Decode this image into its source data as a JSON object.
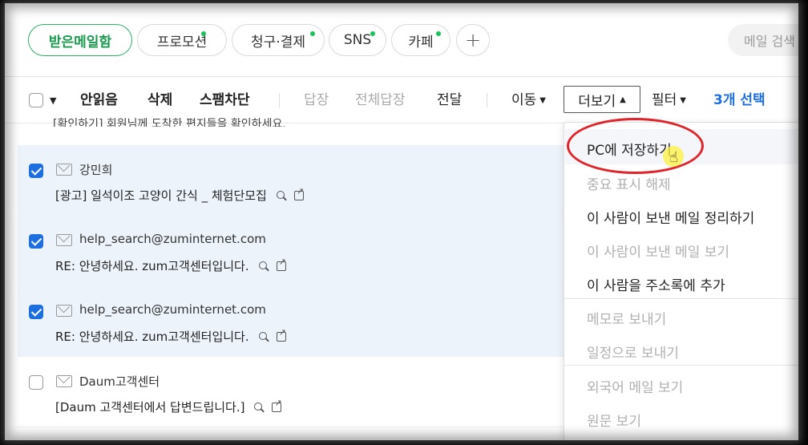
{
  "tabs": [
    {
      "label": "받은메일함",
      "active": true,
      "dot": false
    },
    {
      "label": "프로모션",
      "active": false,
      "dot": true
    },
    {
      "label": "청구·결제",
      "active": false,
      "dot": true
    },
    {
      "label": "SNS",
      "active": false,
      "dot": true
    },
    {
      "label": "카페",
      "active": false,
      "dot": true
    },
    {
      "label": "+",
      "active": false,
      "dot": false
    }
  ],
  "search": {
    "placeholder": "메일 검색"
  },
  "toolbar": {
    "mark_unread": "안읽음",
    "delete": "삭제",
    "block_spam": "스팸차단",
    "reply": "답장",
    "reply_all": "전체답장",
    "forward": "전달",
    "move": "이동",
    "more": "더보기",
    "filter": "필터",
    "selected_count": "3개 선택"
  },
  "mails": [
    {
      "sender": "강민희",
      "subject": "[광고] 일석이조 고양이 간식 _ 체험단모집",
      "selected": true
    },
    {
      "sender": "help_search@zuminternet.com",
      "subject": "RE: 안녕하세요. zum고객센터입니다.",
      "selected": true
    },
    {
      "sender": "help_search@zuminternet.com",
      "subject": "RE: 안녕하세요. zum고객센터입니다.",
      "selected": true
    },
    {
      "sender": "Daum고객센터",
      "subject": "[Daum 고객센터에서 답변드립니다.]",
      "selected": false
    }
  ],
  "clipped_row_text": "[확인하기] 회원님께 도착한 편지들을 확인하세요.",
  "more_menu": [
    {
      "label": "PC에 저장하기",
      "enabled": true
    },
    {
      "label": "중요 표시 해제",
      "enabled": false
    },
    {
      "label": "이 사람이 보낸 메일 정리하기",
      "enabled": true
    },
    {
      "label": "이 사람이 보낸 메일 보기",
      "enabled": false
    },
    {
      "label": "이 사람을 주소록에 추가",
      "enabled": true
    },
    {
      "label": "메모로 보내기",
      "enabled": false
    },
    {
      "label": "일정으로 보내기",
      "enabled": false
    },
    {
      "label": "외국어 메일 보기",
      "enabled": false
    },
    {
      "label": "원문 보기",
      "enabled": false
    }
  ],
  "colors": {
    "accent_green": "#2fb163",
    "accent_blue": "#1d6fe0",
    "highlight_red": "#e0242a"
  }
}
